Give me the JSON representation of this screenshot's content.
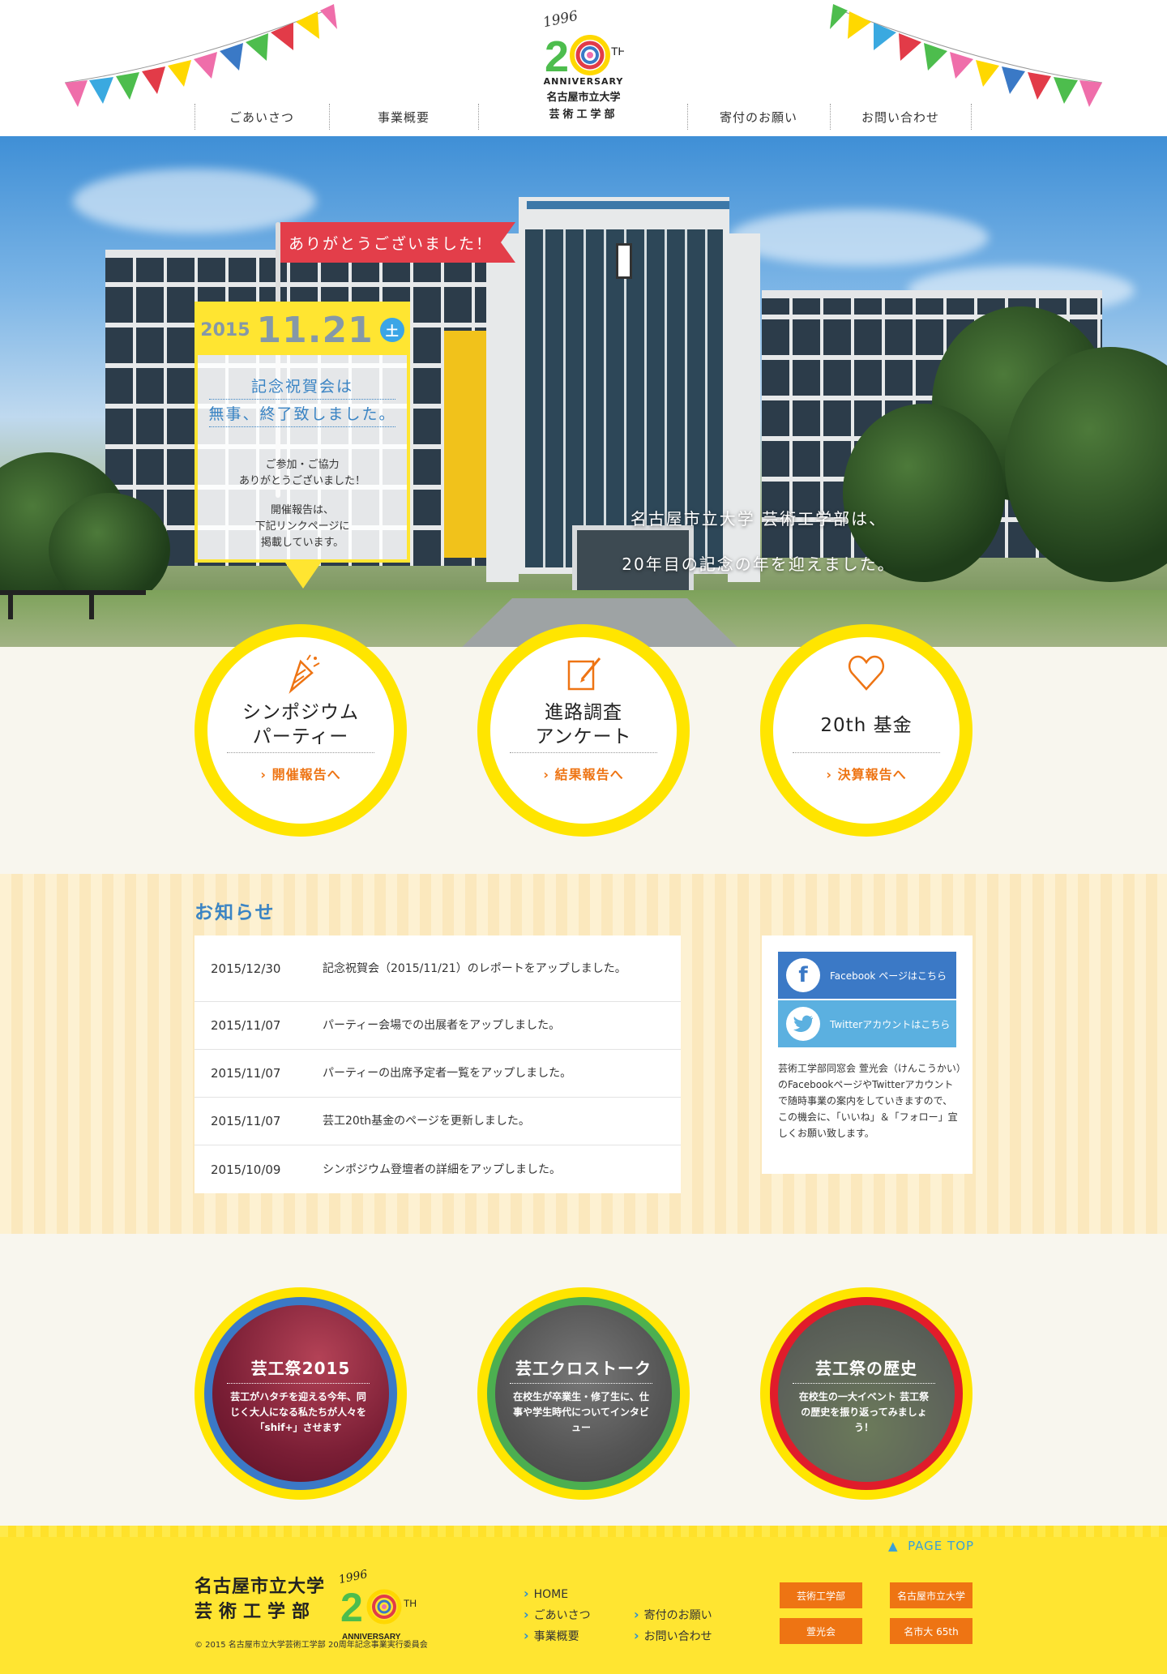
{
  "header": {
    "logo": {
      "year": "1996",
      "num_2": "2",
      "num_0": "0",
      "th": "TH",
      "anniversary": "ANNIVERSARY",
      "university": "名古屋市立大学",
      "department": "芸術工学部"
    },
    "nav": [
      "ごあいさつ",
      "事業概要",
      "寄付のお願い",
      "お問い合わせ"
    ]
  },
  "hero": {
    "flag": "ありがとうございました！",
    "date": {
      "year": "2015",
      "monthday": "11.21",
      "dow": "土"
    },
    "headline_1": "記念祝賀会は",
    "headline_2": "無事、終了致しました。",
    "thanks_1": "ご参加・ご協力",
    "thanks_2": "ありがとうございました！",
    "report_1": "開催報告は、",
    "report_2": "下記リンクページに",
    "report_3": "掲載しています。",
    "caption_1": "名古屋市立大学 芸術工学部は、",
    "caption_2": "20年目の記念の年を迎えました。"
  },
  "circles": [
    {
      "title_1": "シンポジウム",
      "title_2": "パーティー",
      "link": "開催報告へ",
      "icon": "party-popper-icon"
    },
    {
      "title_1": "進路調査",
      "title_2": "アンケート",
      "link": "結果報告へ",
      "icon": "pencil-note-icon"
    },
    {
      "title_1": "20th 基金",
      "title_2": "",
      "link": "決算報告へ",
      "icon": "heart-icon"
    }
  ],
  "news": {
    "heading": "お知らせ",
    "items": [
      {
        "date": "2015/12/30",
        "title": "記念祝賀会（2015/11/21）のレポートをアップしました。"
      },
      {
        "date": "2015/11/07",
        "title": "パーティー会場での出展者をアップしました。"
      },
      {
        "date": "2015/11/07",
        "title": "パーティーの出席予定者一覧をアップしました。"
      },
      {
        "date": "2015/11/07",
        "title": "芸工20th基金のページを更新しました。"
      },
      {
        "date": "2015/10/09",
        "title": "シンポジウム登壇者の詳細をアップしました。"
      }
    ]
  },
  "social": {
    "facebook": "Facebook ページはこちら",
    "twitter": "Twitterアカウントはこちら",
    "text": "芸術工学部同窓会 萱光会（けんこうかい）のFacebookページやTwitterアカウントで随時事業の案内をしていきますので、この機会に、「いいね」＆「フォロー」宜しくお願い致します。",
    "colors": {
      "facebook": "#3b79c6",
      "twitter": "#5bb0e0"
    }
  },
  "features": [
    {
      "title": "芸工祭2015",
      "desc": "芸工がハタチを迎える今年、同じく大人になる私たちが人々を「shif+」させます",
      "ring": "#3b79c6"
    },
    {
      "title": "芸工クロストーク",
      "desc": "在校生が卒業生・修了生に、仕事や学生時代についてインタビュー",
      "ring": "#4caf50"
    },
    {
      "title": "芸工祭の歴史",
      "desc": "在校生の一大イベント 芸工祭の歴史を振り返ってみましょう！",
      "ring": "#e01c2b"
    }
  ],
  "footer": {
    "pagetop": "PAGE TOP",
    "university": "名古屋市立大学",
    "department": "芸術工学部",
    "copyright": "© 2015 名古屋市立大学芸術工学部 20周年記念事業実行委員会",
    "links": [
      "HOME",
      "ごあいさつ",
      "事業概要",
      "寄付のお願い",
      "お問い合わせ"
    ],
    "buttons": [
      "芸術工学部",
      "名古屋市立大学",
      "萱光会",
      "名市大 65th"
    ]
  }
}
